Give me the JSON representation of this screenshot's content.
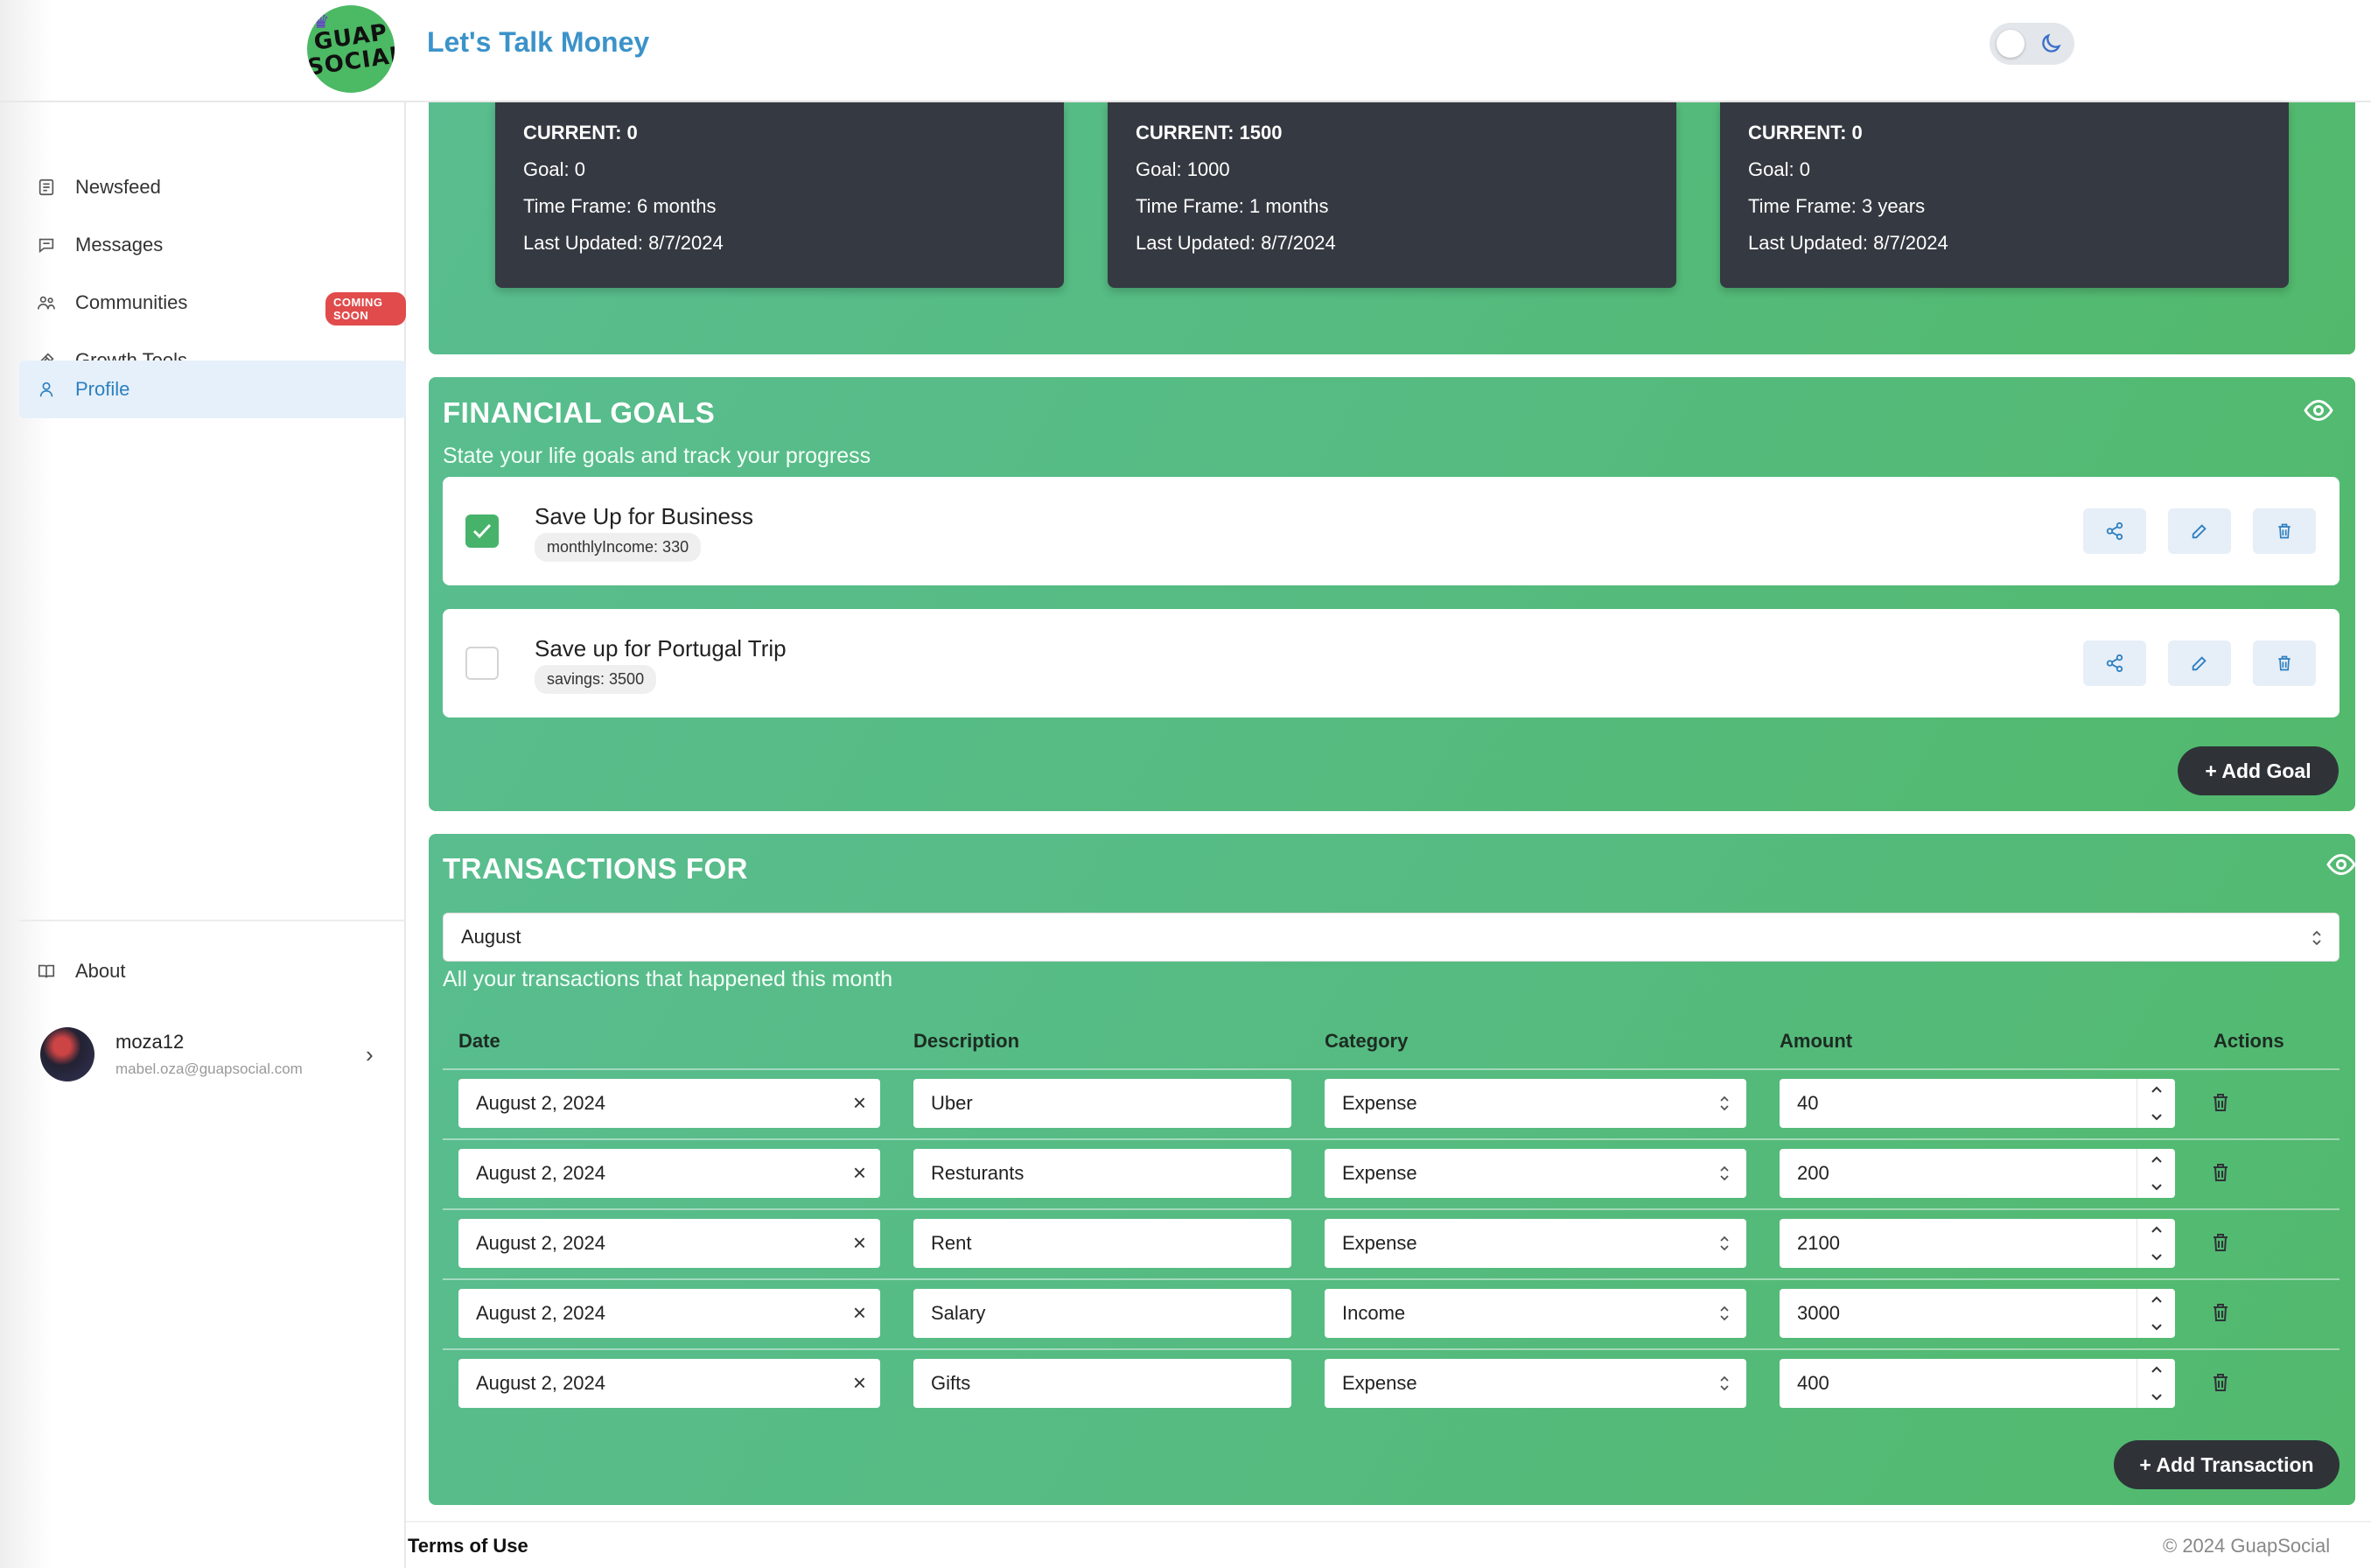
{
  "header": {
    "logo_text_top": "GUAP",
    "logo_text_bottom": "SOCIAL",
    "app_title": "Let's Talk Money"
  },
  "sidebar": {
    "items": [
      {
        "label": "Newsfeed",
        "icon": "newsfeed-icon"
      },
      {
        "label": "Messages",
        "icon": "messages-icon"
      },
      {
        "label": "Communities",
        "icon": "communities-icon",
        "badge": "COMING SOON"
      },
      {
        "label": "Growth Tools",
        "icon": "growth-tools-icon"
      },
      {
        "label": "Profile",
        "icon": "profile-icon",
        "active": true
      }
    ],
    "about_label": "About",
    "user": {
      "name": "moza12",
      "email": "mabel.oza@guapsocial.com"
    }
  },
  "savings": [
    {
      "current": "CURRENT: 0",
      "goal": "Goal: 0",
      "time_frame": "Time Frame: 6 months",
      "last_updated": "Last Updated: 8/7/2024"
    },
    {
      "current": "CURRENT: 1500",
      "goal": "Goal: 1000",
      "time_frame": "Time Frame: 1 months",
      "last_updated": "Last Updated: 8/7/2024"
    },
    {
      "current": "CURRENT: 0",
      "goal": "Goal: 0",
      "time_frame": "Time Frame: 3 years",
      "last_updated": "Last Updated: 8/7/2024"
    }
  ],
  "financial_goals": {
    "title": "FINANCIAL GOALS",
    "subtitle": "State your life goals and track your progress",
    "goals": [
      {
        "title": "Save Up for Business",
        "tag": "monthlyIncome: 330",
        "completed": true
      },
      {
        "title": "Save up for Portugal Trip",
        "tag": "savings: 3500",
        "completed": false
      }
    ],
    "add_button": "+ Add Goal"
  },
  "transactions": {
    "title": "TRANSACTIONS FOR",
    "selected_month": "August",
    "subtitle": "All your transactions that happened this month",
    "columns": [
      "Date",
      "Description",
      "Category",
      "Amount",
      "Actions"
    ],
    "rows": [
      {
        "date": "August 2, 2024",
        "description": "Uber",
        "category": "Expense",
        "amount": "40"
      },
      {
        "date": "August 2, 2024",
        "description": "Resturants",
        "category": "Expense",
        "amount": "200"
      },
      {
        "date": "August 2, 2024",
        "description": "Rent",
        "category": "Expense",
        "amount": "2100"
      },
      {
        "date": "August 2, 2024",
        "description": "Salary",
        "category": "Income",
        "amount": "3000"
      },
      {
        "date": "August 2, 2024",
        "description": "Gifts",
        "category": "Expense",
        "amount": "400"
      }
    ],
    "add_button": "+ Add Transaction"
  },
  "footer": {
    "terms": "Terms of Use",
    "copyright": "© 2024 GuapSocial"
  },
  "colors": {
    "panel_green": "#55bb80",
    "dark_card": "#353941",
    "accent_blue": "#3b93c9",
    "checkbox_green": "#47b36a",
    "badge_red": "#e14b4b"
  }
}
